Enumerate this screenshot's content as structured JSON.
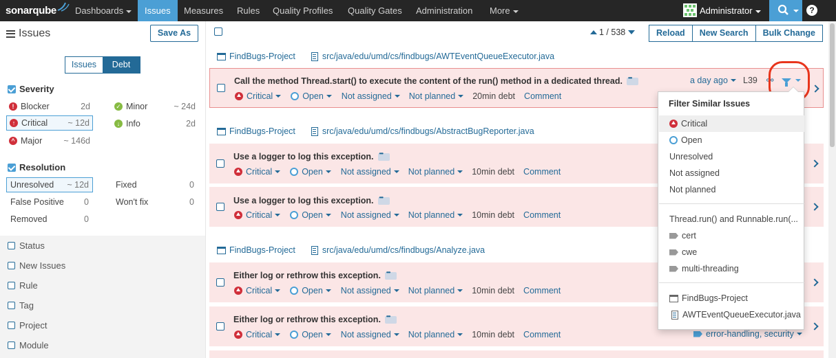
{
  "navbar": {
    "brand": "sonarqube",
    "items": [
      {
        "label": "Dashboards",
        "caret": true,
        "active": false
      },
      {
        "label": "Issues",
        "caret": false,
        "active": true
      },
      {
        "label": "Measures",
        "caret": false,
        "active": false
      },
      {
        "label": "Rules",
        "caret": false,
        "active": false
      },
      {
        "label": "Quality Profiles",
        "caret": false,
        "active": false
      },
      {
        "label": "Quality Gates",
        "caret": false,
        "active": false
      },
      {
        "label": "Administration",
        "caret": false,
        "active": false
      },
      {
        "label": "More",
        "caret": true,
        "active": false
      }
    ],
    "user": "Administrator",
    "help": "?",
    "accent": "#4b9fd5"
  },
  "sidebar": {
    "title": "Issues",
    "save_as": "Save As",
    "mode_issues": "Issues",
    "mode_debt": "Debt",
    "severity": {
      "title": "Severity",
      "items": [
        {
          "label": "Blocker",
          "value": "2d",
          "icon": "blocker-icon",
          "color": "#d02f3a"
        },
        {
          "label": "Minor",
          "value": "~ 24d",
          "icon": "minor-icon",
          "color": "#87bb43"
        },
        {
          "label": "Critical",
          "value": "~ 12d",
          "icon": "critical-icon",
          "color": "#d02f3a",
          "selected": true
        },
        {
          "label": "Info",
          "value": "2d",
          "icon": "info-icon",
          "color": "#87bb43"
        },
        {
          "label": "Major",
          "value": "~ 146d",
          "icon": "major-icon",
          "color": "#d02f3a"
        }
      ]
    },
    "resolution": {
      "title": "Resolution",
      "items": [
        {
          "label": "Unresolved",
          "value": "~ 12d",
          "selected": true
        },
        {
          "label": "Fixed",
          "value": "0"
        },
        {
          "label": "False Positive",
          "value": "0"
        },
        {
          "label": "Won't fix",
          "value": "0"
        },
        {
          "label": "Removed",
          "value": "0"
        }
      ]
    },
    "closed_facets": [
      "Status",
      "New Issues",
      "Rule",
      "Tag",
      "Project",
      "Module"
    ]
  },
  "toolbar": {
    "pager": "1 / 538",
    "reload": "Reload",
    "new_search": "New Search",
    "bulk_change": "Bulk Change"
  },
  "groups": [
    {
      "project": "FindBugs-Project",
      "file": "src/java/edu/umd/cs/findbugs/AWTEventQueueExecutor.java",
      "issues": [
        {
          "message": "Call the method Thread.start() to execute the content of the run() method in a dedicated thread.",
          "severity": "Critical",
          "status": "Open",
          "assignee": "Not assigned",
          "plan": "Not planned",
          "debt": "20min debt",
          "comment": "Comment",
          "age": "a day ago",
          "line": "L39"
        }
      ]
    },
    {
      "project": "FindBugs-Project",
      "file": "src/java/edu/umd/cs/findbugs/AbstractBugReporter.java",
      "issues": [
        {
          "message": "Use a logger to log this exception.",
          "severity": "Critical",
          "status": "Open",
          "assignee": "Not assigned",
          "plan": "Not planned",
          "debt": "10min debt",
          "comment": "Comment"
        },
        {
          "message": "Use a logger to log this exception.",
          "severity": "Critical",
          "status": "Open",
          "assignee": "Not assigned",
          "plan": "Not planned",
          "debt": "10min debt",
          "comment": "Comment"
        }
      ]
    },
    {
      "project": "FindBugs-Project",
      "file": "src/java/edu/umd/cs/findbugs/Analyze.java",
      "issues": [
        {
          "message": "Either log or rethrow this exception.",
          "severity": "Critical",
          "status": "Open",
          "assignee": "Not assigned",
          "plan": "Not planned",
          "debt": "10min debt",
          "comment": "Comment"
        },
        {
          "message": "Either log or rethrow this exception.",
          "severity": "Critical",
          "status": "Open",
          "assignee": "Not assigned",
          "plan": "Not planned",
          "debt": "10min debt",
          "comment": "Comment",
          "tags": "error-handling, security"
        }
      ]
    }
  ],
  "dropdown": {
    "title": "Filter Similar Issues",
    "items": [
      "Critical",
      "Open",
      "Unresolved",
      "Not assigned",
      "Not planned"
    ],
    "rule": "Thread.run() and Runnable.run(...",
    "tags": [
      "cert",
      "cwe",
      "multi-threading"
    ],
    "project": "FindBugs-Project",
    "file": "AWTEventQueueExecutor.java"
  }
}
